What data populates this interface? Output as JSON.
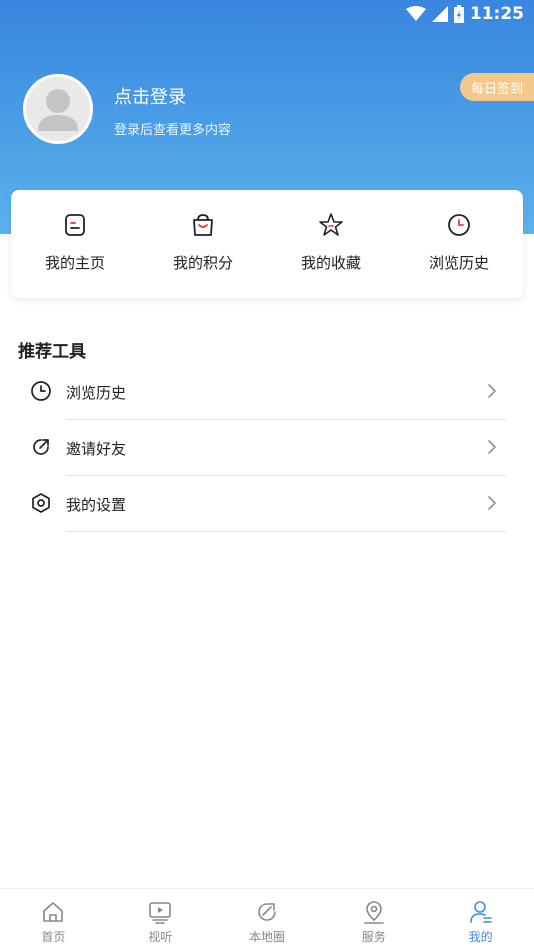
{
  "status_bar": {
    "time": "11:25"
  },
  "profile": {
    "login_title": "点击登录",
    "login_subtitle": "登录后查看更多内容",
    "daily_signin": "每日签到"
  },
  "quick_actions": [
    {
      "label": "我的主页",
      "icon": "note-icon"
    },
    {
      "label": "我的积分",
      "icon": "bag-icon"
    },
    {
      "label": "我的收藏",
      "icon": "star-icon"
    },
    {
      "label": "浏览历史",
      "icon": "clock-icon"
    }
  ],
  "tools": {
    "title": "推荐工具",
    "items": [
      {
        "label": "浏览历史",
        "icon": "clock-icon"
      },
      {
        "label": "邀请好友",
        "icon": "share-arrow-icon"
      },
      {
        "label": "我的设置",
        "icon": "hexagon-settings-icon"
      }
    ]
  },
  "tabbar": {
    "items": [
      {
        "label": "首页",
        "icon": "home-icon"
      },
      {
        "label": "视听",
        "icon": "tv-icon"
      },
      {
        "label": "本地圈",
        "icon": "local-circle-icon"
      },
      {
        "label": "服务",
        "icon": "location-pin-icon"
      },
      {
        "label": "我的",
        "icon": "user-icon"
      }
    ],
    "active_index": 4,
    "active_color": "#3b8de0",
    "inactive_color": "#888888"
  },
  "colors": {
    "header_gradient_top": "#3a85e0",
    "header_gradient_bottom": "#5cb2ec",
    "signin_badge": "#f3c88a",
    "accent_red": "#e33a3a"
  }
}
